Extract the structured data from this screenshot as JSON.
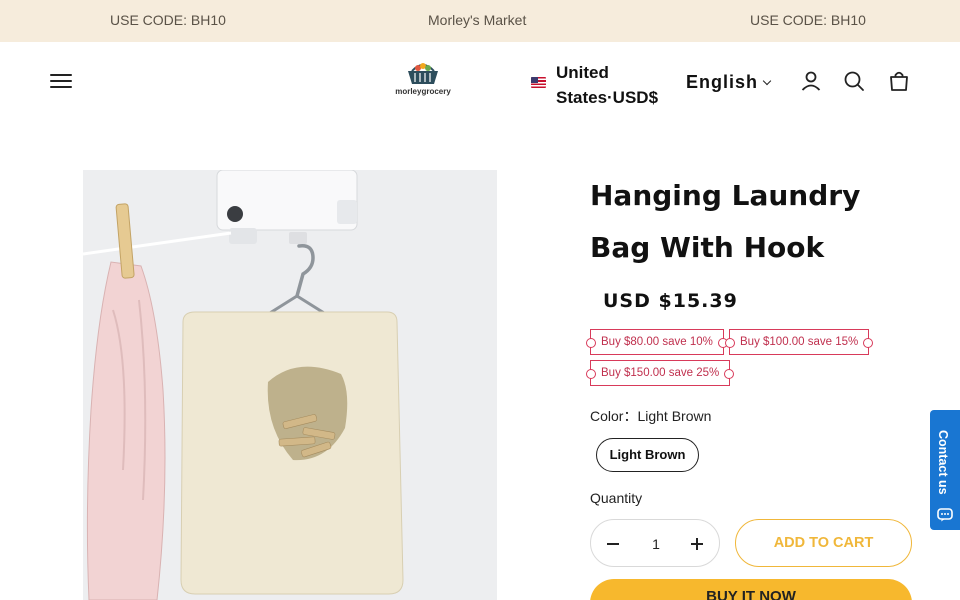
{
  "announcement": {
    "items": [
      "USE CODE: BH10",
      "Morley's Market",
      "USE CODE: BH10"
    ]
  },
  "header": {
    "logo_text": "morleygrocery",
    "region_line1": "United",
    "region_line2": "States·USD$",
    "language": "English",
    "icons": [
      "menu-icon",
      "account-icon",
      "search-icon",
      "cart-icon"
    ]
  },
  "product": {
    "title_line1": "Hanging Laundry",
    "title_line2": "Bag With Hook",
    "price": "USD $15.39",
    "discounts": [
      "Buy $80.00 save 10%",
      "Buy $100.00 save 15%",
      "Buy $150.00 save 25%"
    ],
    "color_label": "Color：Light Brown",
    "color_option": "Light Brown",
    "quantity_label": "Quantity",
    "quantity_value": "1",
    "add_to_cart": "ADD TO CART",
    "buy_now": "BUY IT NOW"
  },
  "contact": {
    "label": "Contact us"
  },
  "colors": {
    "announcement_bg": "#f6ecdc",
    "accent": "#f7b82d",
    "badge": "#d83a5a",
    "contact_bg": "#1976d2"
  }
}
